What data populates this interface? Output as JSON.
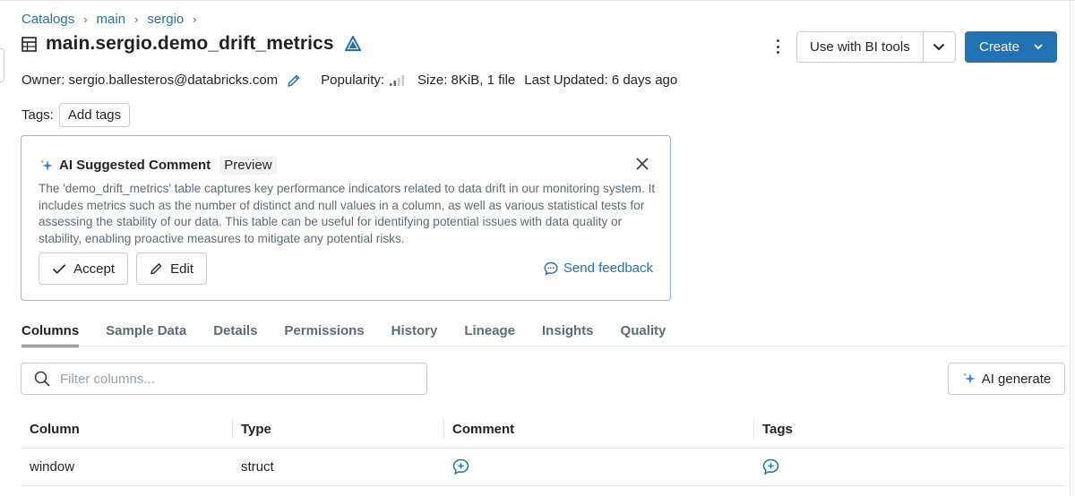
{
  "breadcrumb": {
    "items": [
      "Catalogs",
      "main",
      "sergio"
    ],
    "separator": "›"
  },
  "header": {
    "title": "main.sergio.demo_drift_metrics",
    "bi_button": "Use with BI tools",
    "create_button": "Create"
  },
  "meta": {
    "owner": "Owner: sergio.ballesteros@databricks.com",
    "popularity_label": "Popularity:",
    "size": "Size: 8KiB, 1 file",
    "last_updated": "Last Updated: 6 days ago"
  },
  "tags": {
    "label": "Tags:",
    "add_button": "Add tags"
  },
  "ai_comment": {
    "title": "AI Suggested Comment",
    "badge": "Preview",
    "body": "The 'demo_drift_metrics' table captures key performance indicators related to data drift in our monitoring system. It includes metrics such as the number of distinct and null values in a column, as well as various statistical tests for assessing the stability of our data. This table can be useful for identifying potential issues with data quality or stability, enabling proactive measures to mitigate any potential risks.",
    "accept_label": "Accept",
    "edit_label": "Edit",
    "feedback_label": "Send feedback"
  },
  "tabs": [
    "Columns",
    "Sample Data",
    "Details",
    "Permissions",
    "History",
    "Lineage",
    "Insights",
    "Quality"
  ],
  "filter": {
    "placeholder": "Filter columns..."
  },
  "ai_generate_label": "AI generate",
  "table": {
    "headers": [
      "Column",
      "Type",
      "Comment",
      "Tags"
    ],
    "rows": [
      {
        "column": "window",
        "type": "struct"
      }
    ]
  },
  "colors": {
    "accent": "#2272b4",
    "card_border": "#8fbbe6",
    "sparkle": "#3b82d6"
  }
}
